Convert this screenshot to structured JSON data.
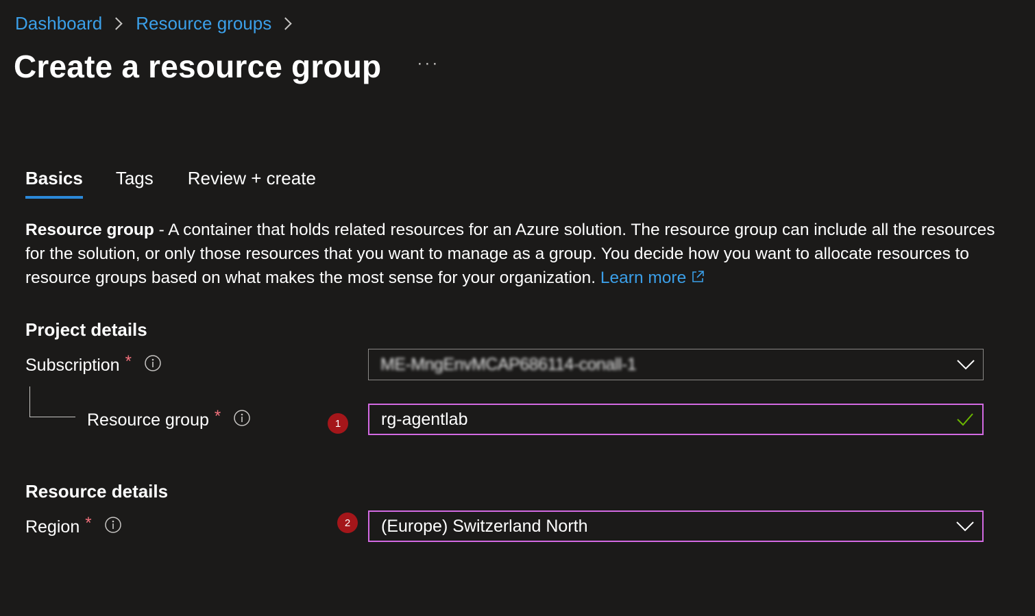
{
  "breadcrumb": {
    "items": [
      "Dashboard",
      "Resource groups"
    ]
  },
  "page": {
    "title": "Create a resource group",
    "more_label": "···"
  },
  "tabs": [
    {
      "label": "Basics",
      "active": true
    },
    {
      "label": "Tags",
      "active": false
    },
    {
      "label": "Review + create",
      "active": false
    }
  ],
  "description": {
    "bold": "Resource group",
    "text": " - A container that holds related resources for an Azure solution. The resource group can include all the resources for the solution, or only those resources that you want to manage as a group. You decide how you want to allocate resources to resource groups based on what makes the most sense for your organization. ",
    "link": "Learn more"
  },
  "project_details": {
    "heading": "Project details",
    "subscription": {
      "label": "Subscription",
      "required_mark": "*",
      "value": "ME-MngEnvMCAP686114-conall-1"
    },
    "resource_group": {
      "label": "Resource group",
      "required_mark": "*",
      "value": "rg-agentlab",
      "badge": "1"
    }
  },
  "resource_details": {
    "heading": "Resource details",
    "region": {
      "label": "Region",
      "required_mark": "*",
      "value": "(Europe) Switzerland North",
      "badge": "2"
    }
  },
  "colors": {
    "background": "#1b1a19",
    "link": "#3b9fe8",
    "tab_underline": "#2b88d8",
    "focus_border": "#d36ae3",
    "required": "#f1707b",
    "badge": "#a4161a",
    "valid_check": "#6bb700"
  },
  "icons": {
    "breadcrumb_separator": "chevron-right-icon",
    "info": "info-icon",
    "dropdown": "chevron-down-icon",
    "valid": "checkmark-icon",
    "external": "external-link-icon"
  }
}
